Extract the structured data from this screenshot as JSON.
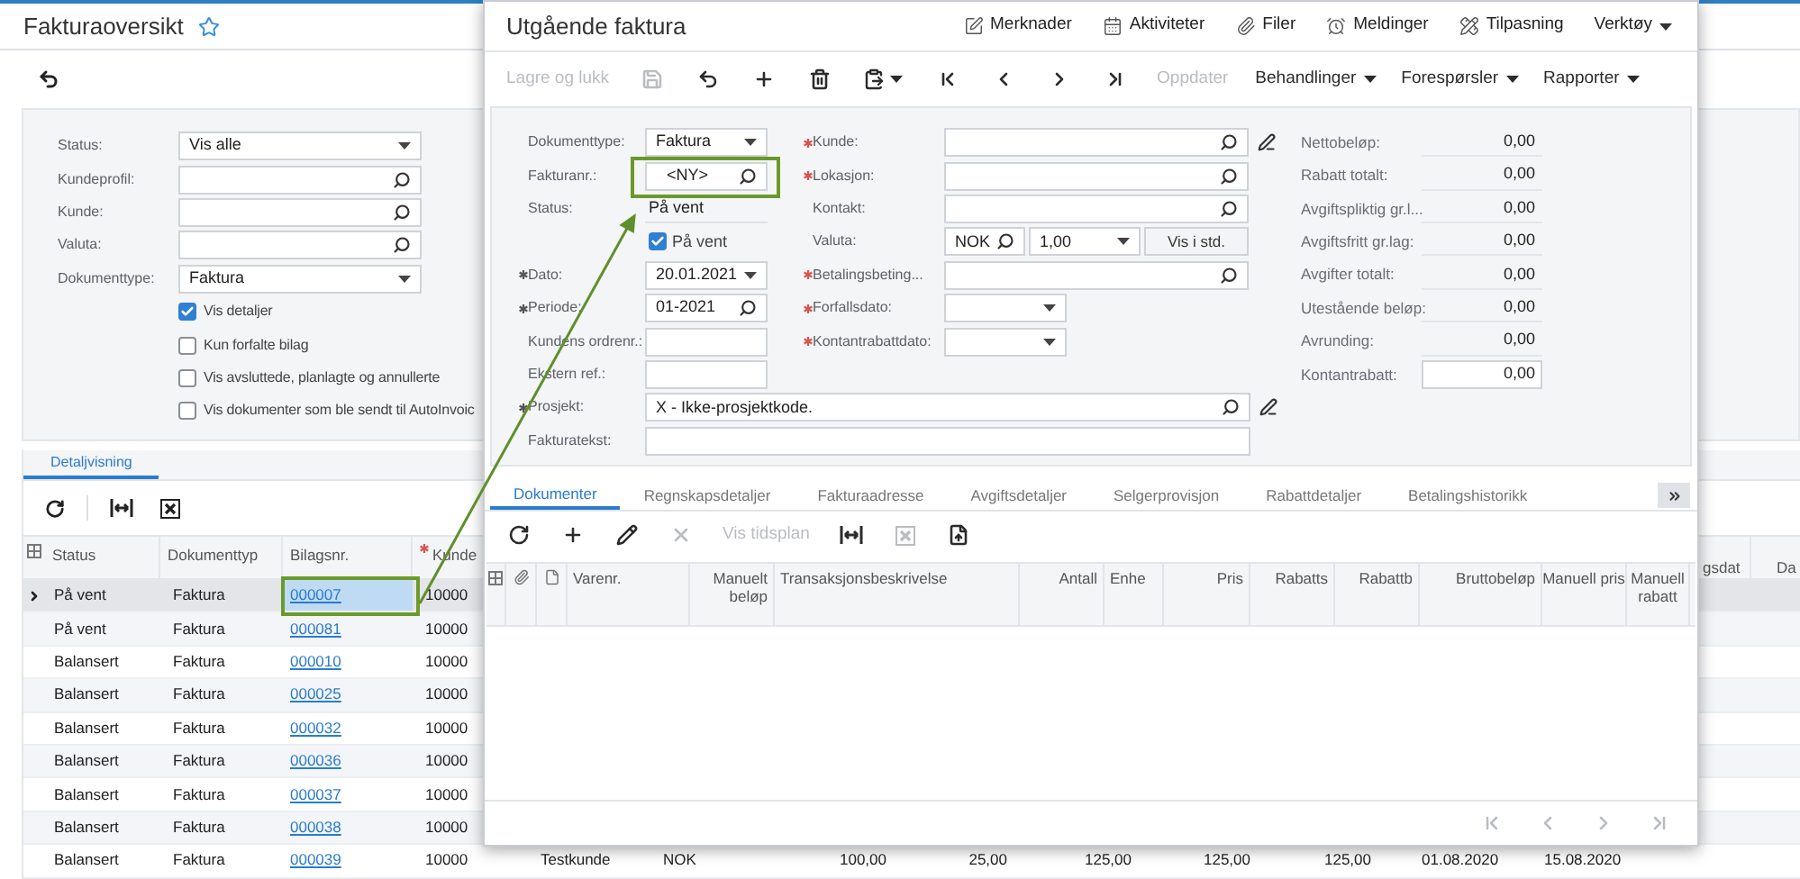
{
  "page": {
    "title": "Fakturaoversikt"
  },
  "filters": [
    {
      "label": "Status:",
      "kind": "select",
      "value": "Vis alle"
    },
    {
      "label": "Kundeprofil:",
      "kind": "lookup"
    },
    {
      "label": "Kunde:",
      "kind": "lookup"
    },
    {
      "label": "Valuta:",
      "kind": "lookup"
    },
    {
      "label": "Dokumenttype:",
      "kind": "select",
      "value": "Faktura"
    }
  ],
  "filter_options": [
    {
      "label": "Vis detaljer",
      "checked": true
    },
    {
      "label": "Kun forfalte bilag",
      "checked": false
    },
    {
      "label": "Vis avsluttede, planlagte og annullerte",
      "checked": false
    },
    {
      "label": "Vis dokumenter som ble sendt til AutoInvoic",
      "checked": false
    }
  ],
  "tabs": [
    {
      "label": "Detaljvisning",
      "selected": true
    }
  ],
  "grid": {
    "columns": [
      {
        "label": "Status",
        "required": false
      },
      {
        "label": "Dokumenttyp",
        "required": false
      },
      {
        "label": "Bilagsnr.",
        "required": false
      },
      {
        "label": "Kunde",
        "required": true
      }
    ],
    "right_columns": [
      "gsdat",
      "Da"
    ],
    "rows": [
      {
        "status": "På vent",
        "doc_type": "Faktura",
        "number": "000007",
        "customer": "10000",
        "selected": true
      },
      {
        "status": "På vent",
        "doc_type": "Faktura",
        "number": "000081",
        "customer": "10000",
        "selected": false
      },
      {
        "status": "Balansert",
        "doc_type": "Faktura",
        "number": "000010",
        "customer": "10000",
        "selected": false
      },
      {
        "status": "Balansert",
        "doc_type": "Faktura",
        "number": "000025",
        "customer": "10000",
        "selected": false
      },
      {
        "status": "Balansert",
        "doc_type": "Faktura",
        "number": "000032",
        "customer": "10000",
        "selected": false
      },
      {
        "status": "Balansert",
        "doc_type": "Faktura",
        "number": "000036",
        "customer": "10000",
        "selected": false
      },
      {
        "status": "Balansert",
        "doc_type": "Faktura",
        "number": "000037",
        "customer": "10000",
        "selected": false
      },
      {
        "status": "Balansert",
        "doc_type": "Faktura",
        "number": "000038",
        "customer": "10000",
        "selected": false
      },
      {
        "status": "Balansert",
        "doc_type": "Faktura",
        "number": "000039",
        "customer": "10000",
        "selected": false,
        "more": [
          "Testkunde",
          "NOK",
          "100,00",
          "25,00",
          "125,00",
          "125,00",
          "125,00",
          "01.08.2020",
          "15.08.2020"
        ]
      }
    ]
  },
  "dialog": {
    "title": "Utgående faktura",
    "actions": [
      {
        "label": "Merknader",
        "kind": "notes"
      },
      {
        "label": "Aktiviteter",
        "kind": "activities"
      },
      {
        "label": "Filer",
        "kind": "files"
      },
      {
        "label": "Meldinger",
        "kind": "alerts"
      },
      {
        "label": "Tilpasning",
        "kind": "customize"
      },
      {
        "label": "Verktøy",
        "kind": "menu"
      }
    ],
    "toolbar": [
      {
        "kind": "text",
        "label": "Lagre og lukk",
        "disabled": true
      },
      {
        "kind": "save",
        "disabled": true
      },
      {
        "kind": "undo",
        "disabled": false
      },
      {
        "kind": "add",
        "disabled": false
      },
      {
        "kind": "delete",
        "disabled": false
      },
      {
        "kind": "clipboard",
        "disabled": false
      },
      {
        "kind": "first",
        "disabled": false
      },
      {
        "kind": "prev",
        "disabled": false
      },
      {
        "kind": "next",
        "disabled": false
      },
      {
        "kind": "last",
        "disabled": false
      },
      {
        "kind": "text",
        "label": "Oppdater",
        "disabled": true
      },
      {
        "kind": "menu",
        "label": "Behandlinger",
        "disabled": false
      },
      {
        "kind": "menu",
        "label": "Forespørsler",
        "disabled": false
      },
      {
        "kind": "menu",
        "label": "Rapporter",
        "disabled": false
      }
    ],
    "left_fields": [
      {
        "label": "Dokumenttype:",
        "kind": "select",
        "value": "Faktura",
        "required": false
      },
      {
        "label": "Fakturanr.:",
        "kind": "lookup",
        "value": "<NY>",
        "required": false
      },
      {
        "label": "Status:",
        "kind": "text",
        "value": "På vent",
        "required": false
      },
      {
        "kind": "checkbox",
        "value": "På vent",
        "checked": true
      },
      {
        "label": "Dato:",
        "kind": "select",
        "value": "20.01.2021",
        "required": true
      },
      {
        "label": "Periode:",
        "kind": "lookup",
        "value": "01-2021",
        "required": true
      },
      {
        "label": "Kundens ordrenr.:",
        "kind": "input",
        "required": false
      },
      {
        "label": "Ekstern ref.:",
        "kind": "input",
        "required": false
      }
    ],
    "middle_fields": [
      {
        "label": "Kunde:",
        "kind": "lookup",
        "required": true,
        "edit": true
      },
      {
        "label": "Lokasjon:",
        "kind": "lookup",
        "required": true,
        "edit": false
      },
      {
        "label": "Kontakt:",
        "kind": "lookup",
        "required": false,
        "edit": false
      },
      {
        "label": "Valuta:",
        "kind": "currency",
        "value": "NOK",
        "rate": "1,00",
        "button": "Vis i std.",
        "required": false,
        "edit": false
      },
      {
        "label": "Betalingsbeting...",
        "kind": "lookup",
        "required": true,
        "edit": false
      },
      {
        "label": "Forfallsdato:",
        "kind": "date",
        "required": true,
        "edit": false
      },
      {
        "label": "Kontantrabattdato:",
        "kind": "date",
        "required": true,
        "edit": false
      }
    ],
    "totals": [
      {
        "label": "Nettobeløp:",
        "value": "0,00",
        "kind": "text"
      },
      {
        "label": "Rabatt totalt:",
        "value": "0,00",
        "kind": "text"
      },
      {
        "label": "Avgiftspliktig gr.l...",
        "value": "0,00",
        "kind": "text"
      },
      {
        "label": "Avgiftsfritt gr.lag:",
        "value": "0,00",
        "kind": "text"
      },
      {
        "label": "Avgifter totalt:",
        "value": "0,00",
        "kind": "text"
      },
      {
        "label": "Utestående beløp:",
        "value": "0,00",
        "kind": "text"
      },
      {
        "label": "Avrunding:",
        "value": "0,00",
        "kind": "text"
      },
      {
        "label": "Kontantrabatt:",
        "value": "0,00",
        "kind": "input"
      }
    ],
    "wide_fields": [
      {
        "label": "Prosjekt:",
        "kind": "lookup",
        "value": "X - Ikke-prosjektkode.",
        "required": true,
        "edit": true
      },
      {
        "label": "Fakturatekst:",
        "kind": "input",
        "required": false,
        "edit": false
      }
    ],
    "tabs": [
      {
        "label": "Dokumenter",
        "selected": true
      },
      {
        "label": "Regnskapsdetaljer",
        "selected": false
      },
      {
        "label": "Fakturaadresse",
        "selected": false
      },
      {
        "label": "Avgiftsdetaljer",
        "selected": false
      },
      {
        "label": "Selgerprovisjon",
        "selected": false
      },
      {
        "label": "Rabattdetaljer",
        "selected": false
      },
      {
        "label": "Betalingshistorikk",
        "selected": false
      }
    ],
    "grid_toolbar": [
      {
        "kind": "refresh",
        "disabled": false
      },
      {
        "kind": "add",
        "disabled": false
      },
      {
        "kind": "edit",
        "disabled": false
      },
      {
        "kind": "remove",
        "disabled": true
      },
      {
        "kind": "text",
        "label": "Vis tidsplan",
        "disabled": true
      },
      {
        "kind": "fit",
        "disabled": false
      },
      {
        "kind": "excel",
        "disabled": true
      },
      {
        "kind": "upload",
        "disabled": false
      }
    ],
    "columns": [
      "Varenr.",
      "Manuelt beløp",
      "Transaksjonsbeskrivelse",
      "Antall",
      "Enhe",
      "Pris",
      "Rabatts",
      "Rabattb",
      "Bruttobeløp",
      "Manuell pris",
      "Manuell rabatt"
    ],
    "pager": [
      {
        "kind": "first",
        "disabled": true
      },
      {
        "kind": "prev",
        "disabled": true
      },
      {
        "kind": "next",
        "disabled": true
      },
      {
        "kind": "last",
        "disabled": true
      }
    ]
  }
}
